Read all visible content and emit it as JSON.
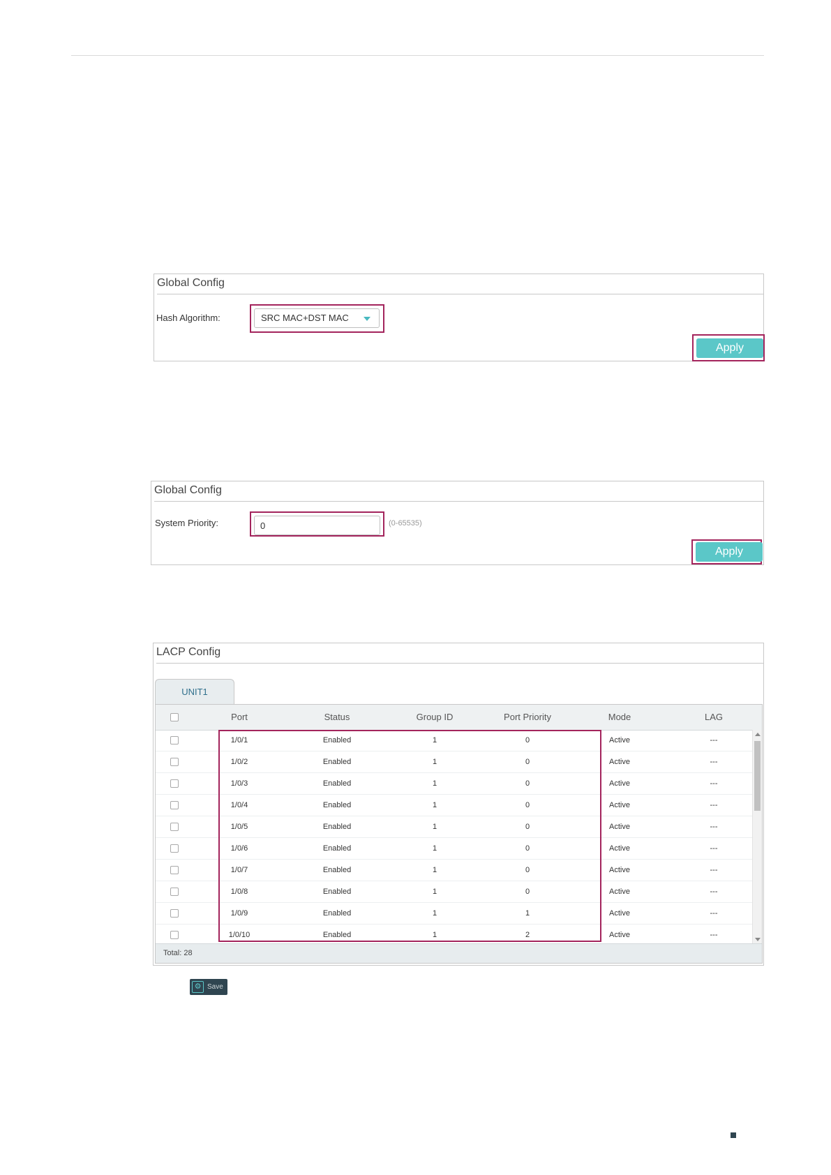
{
  "hash_panel": {
    "title": "Global Config",
    "hash_label": "Hash Algorithm:",
    "hash_value": "SRC MAC+DST MAC",
    "apply_label": "Apply"
  },
  "priority_panel": {
    "title": "Global Config",
    "priority_label": "System Priority:",
    "priority_value": "0",
    "priority_hint": "(0-65535)",
    "apply_label": "Apply"
  },
  "lacp_panel": {
    "title": "LACP Config",
    "tab_label": "UNIT1",
    "columns": [
      "Port",
      "Status",
      "Group ID",
      "Port Priority",
      "Mode",
      "LAG"
    ],
    "rows": [
      [
        "1/0/1",
        "Enabled",
        "1",
        "0",
        "Active",
        "---"
      ],
      [
        "1/0/2",
        "Enabled",
        "1",
        "0",
        "Active",
        "---"
      ],
      [
        "1/0/3",
        "Enabled",
        "1",
        "0",
        "Active",
        "---"
      ],
      [
        "1/0/4",
        "Enabled",
        "1",
        "0",
        "Active",
        "---"
      ],
      [
        "1/0/5",
        "Enabled",
        "1",
        "0",
        "Active",
        "---"
      ],
      [
        "1/0/6",
        "Enabled",
        "1",
        "0",
        "Active",
        "---"
      ],
      [
        "1/0/7",
        "Enabled",
        "1",
        "0",
        "Active",
        "---"
      ],
      [
        "1/0/8",
        "Enabled",
        "1",
        "0",
        "Active",
        "---"
      ],
      [
        "1/0/9",
        "Enabled",
        "1",
        "1",
        "Active",
        "---"
      ],
      [
        "1/0/10",
        "Enabled",
        "1",
        "2",
        "Active",
        "---"
      ]
    ],
    "total_label": "Total: 28"
  },
  "save": {
    "label": "Save",
    "icon": "save-settings-icon"
  },
  "colors": {
    "apply_button": "#5bc7c8",
    "highlight": "#a3245c",
    "save_button": "#2f4550"
  }
}
